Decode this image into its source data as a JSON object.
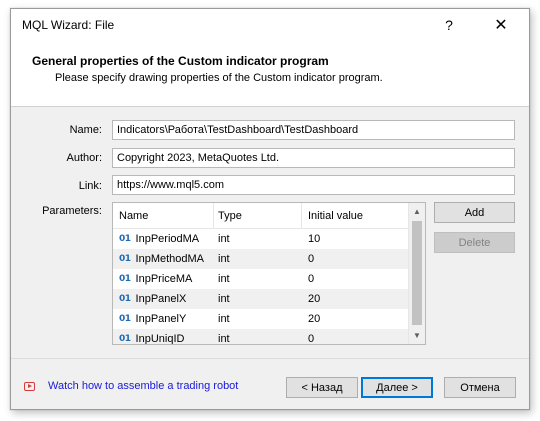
{
  "window": {
    "title": "MQL Wizard: File",
    "help_label": "?",
    "close_label": "✕"
  },
  "header": {
    "title": "General properties of the Custom indicator program",
    "subtitle": "Please specify drawing properties of the Custom indicator program."
  },
  "form": {
    "name_label": "Name:",
    "name_value": "Indicators\\Работа\\TestDashboard\\TestDashboard",
    "author_label": "Author:",
    "author_value": "Copyright 2023, MetaQuotes Ltd.",
    "link_label": "Link:",
    "link_value": "https://www.mql5.com",
    "parameters_label": "Parameters:"
  },
  "parameters": {
    "columns": [
      "Name",
      "Type",
      "Initial value"
    ],
    "rows": [
      {
        "icon": "input-variable-icon",
        "name": "InpPeriodMA",
        "type": "int",
        "value": "10"
      },
      {
        "icon": "input-variable-icon",
        "name": "InpMethodMA",
        "type": "int",
        "value": "0"
      },
      {
        "icon": "input-variable-icon",
        "name": "InpPriceMA",
        "type": "int",
        "value": "0"
      },
      {
        "icon": "input-variable-icon",
        "name": "InpPanelX",
        "type": "int",
        "value": "20"
      },
      {
        "icon": "input-variable-icon",
        "name": "InpPanelY",
        "type": "int",
        "value": "20"
      },
      {
        "icon": "input-variable-icon",
        "name": "InpUniqID",
        "type": "int",
        "value": "0"
      }
    ],
    "row_icon_glyph": "01"
  },
  "buttons": {
    "add": "Add",
    "delete": "Delete",
    "back": "< Назад",
    "next": "Далее >",
    "cancel": "Отмена"
  },
  "footer": {
    "video_link": "Watch how to assemble a trading robot",
    "video_icon": "play-video-icon"
  },
  "colors": {
    "accent": "#0078d7",
    "link": "#1a1ad8",
    "video_icon": "#d83b3b",
    "param_icon": "#1f6bb5"
  }
}
